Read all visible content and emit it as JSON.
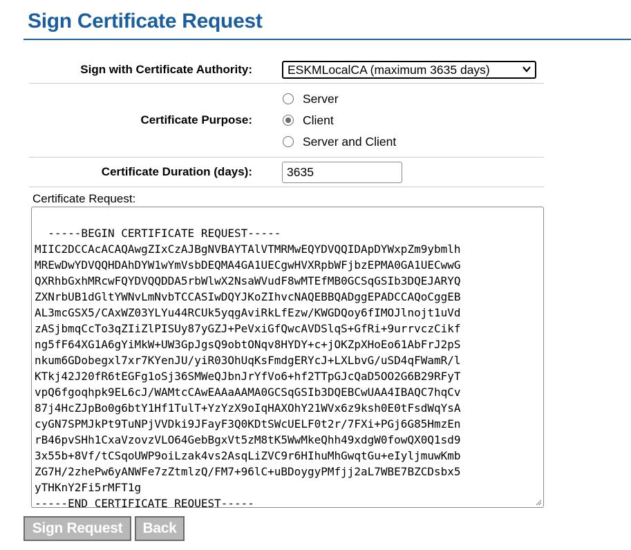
{
  "page": {
    "title": "Sign Certificate Request"
  },
  "form": {
    "ca_label": "Sign with Certificate Authority:",
    "ca_selected": "ESKMLocalCA (maximum 3635 days)",
    "purpose_label": "Certificate Purpose:",
    "purpose_options": [
      {
        "label": "Server",
        "checked": false
      },
      {
        "label": "Client",
        "checked": true
      },
      {
        "label": "Server and Client",
        "checked": false
      }
    ],
    "duration_label": "Certificate Duration (days):",
    "duration_value": "3635",
    "request_label": "Certificate Request:",
    "request_text": "-----BEGIN CERTIFICATE REQUEST-----\nMIIC2DCCAcACAQAwgZIxCzAJBgNVBAYTAlVTMRMwEQYDVQQIDApDYWxpZm9ybmlh\nMREwDwYDVQQHDAhDYW1wYmVsbDEQMA4GA1UECgwHVXRpbWFjbzEPMA0GA1UECwwG\nQXRhbGxhMRcwFQYDVQQDDA5rbWlwX2NsaWVudF8wMTEfMB0GCSqGSIb3DQEJARYQ\nZXNrbUB1dGltYWNvLmNvbTCCASIwDQYJKoZIhvcNAQEBBQADggEPADCCAQoCggEB\nAL3mcGSX5/CAxWZ03YLYu44RCUk5yqgAviRkLfEzw/KWGDQoy6fIMOJlnojt1uVd\nzASjbmqCcTo3qZIiZlPISUy87yGZJ+PeVxiGfQwcAVDSlqS+GfRi+9urrvczCikf\nng5fF64XG1A6gYiMkW+UW3GpJgsQ9obtONqv8HYDY+c+jOKZpXHoEo61AbFrJ2pS\nnkum6GDobegxl7xr7KYenJU/yiR03OhUqKsFmdgERYcJ+LXLbvG/uSD4qFWamR/l\nKTkj42J20fR6tEGFg1oSj36SMWeQJbnJrYfVo6+hf2TTpGJcQaD5OO2G6B29RFyT\nvpQ6fgoqhpk9EL6cJ/WAMtcCAwEAAaAAMA0GCSqGSIb3DQEBCwUAA4IBAQC7hqCv\n87j4HcZJpBo0g6btY1Hf1TulT+YzYzX9oIqHAXOhY21WVx6z9ksh0E0tFsdWqYsA\ncyGN7SPMJkPt9TuNPjVVDki9JFayF3Q0KDtSWcUELF0t2r/7FXi+PGj6G85HmzEn\nrB46pvSHh1CxaVzovzVLO64GebBgxVt5zM8tK5WwMkeQhh49xdgW0fowQX0Q1sd9\n3x55b+8Vf/tCSqoUWP9oiLzak4vs2AsqLiZVC9r6HIhuMhGwqtGu+eIyljmuwKmb\nZG7H/2zhePw6yANWFe7zZtmlzQ/FM7+96lC+uBDoygyPMfjj2aL7WBE7BZCDsbx5\nyTHKnY2Fi5rMFT1g\n-----END CERTIFICATE REQUEST-----"
  },
  "buttons": {
    "sign_label": "Sign Request",
    "back_label": "Back"
  },
  "colors": {
    "title": "#1a5e9e",
    "button_bg": "#b8b8b8"
  }
}
